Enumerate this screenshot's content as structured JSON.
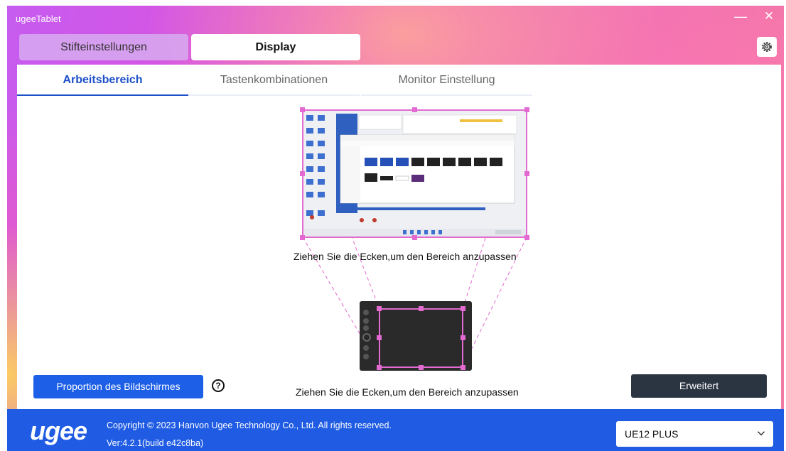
{
  "window": {
    "title": "ugeeTablet",
    "minimize_glyph": "—",
    "close_glyph": "✕"
  },
  "top_tabs": [
    {
      "label": "Stifteinstellungen",
      "active": false
    },
    {
      "label": "Display",
      "active": true
    }
  ],
  "sub_tabs": [
    {
      "label": "Arbeitsbereich",
      "active": true
    },
    {
      "label": "Tastenkombinationen",
      "active": false
    },
    {
      "label": "Monitor Einstellung",
      "active": false
    }
  ],
  "workspace": {
    "monitor_hint": "Ziehen Sie die Ecken,um den Bereich anzupassen",
    "tablet_hint": "Ziehen Sie die Ecken,um den Bereich anzupassen"
  },
  "buttons": {
    "proportion": "Proportion des Bildschirmes",
    "help_glyph": "?",
    "advanced": "Erweitert"
  },
  "footer": {
    "logo": "ugee",
    "copyright": "Copyright © 2023 Hanvon Ugee Technology Co., Ltd. All rights reserved.",
    "version": "Ver:4.2.1(build e42c8ba)",
    "device": "UE12 PLUS"
  },
  "colors": {
    "accent_blue": "#1d5fe6",
    "area_pink": "#e26ad0",
    "dark_button": "#2b3441"
  },
  "icons": [
    "gear-icon",
    "help-icon",
    "chevron-down-icon",
    "minimize-icon",
    "close-icon"
  ]
}
